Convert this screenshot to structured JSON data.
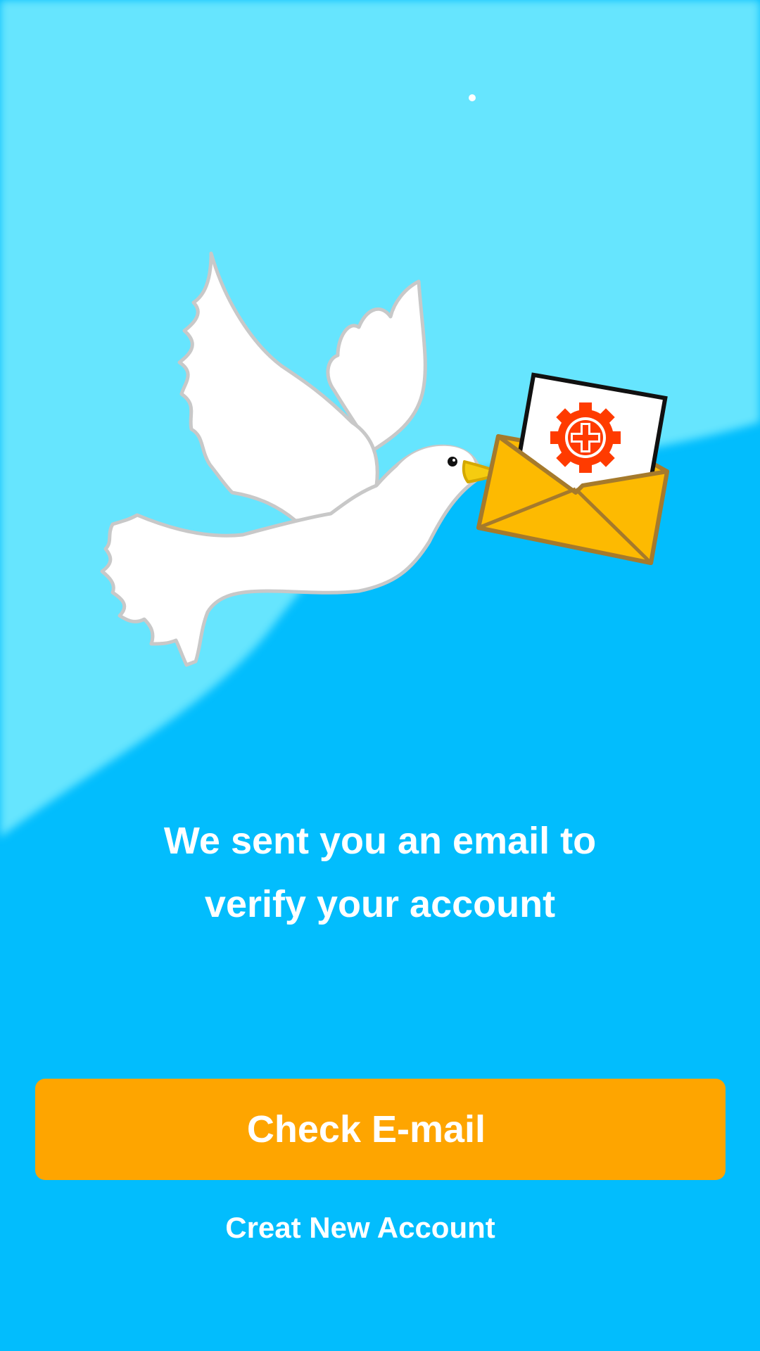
{
  "screen": {
    "message_line1": "We sent you an email to",
    "message_line2": "verify your account",
    "primary_button_label": "Check E-mail",
    "secondary_link_label": "Creat New Account"
  },
  "illustration": {
    "bird_icon": "dove-icon",
    "envelope_icon": "envelope-icon",
    "badge_icon": "medical-gear-icon"
  },
  "colors": {
    "background": "#02bdfd",
    "sky_light": "#66e5fe",
    "primary_button": "#fea500",
    "envelope": "#fdba01",
    "badge": "#ff3b00",
    "text": "#ffffff"
  }
}
